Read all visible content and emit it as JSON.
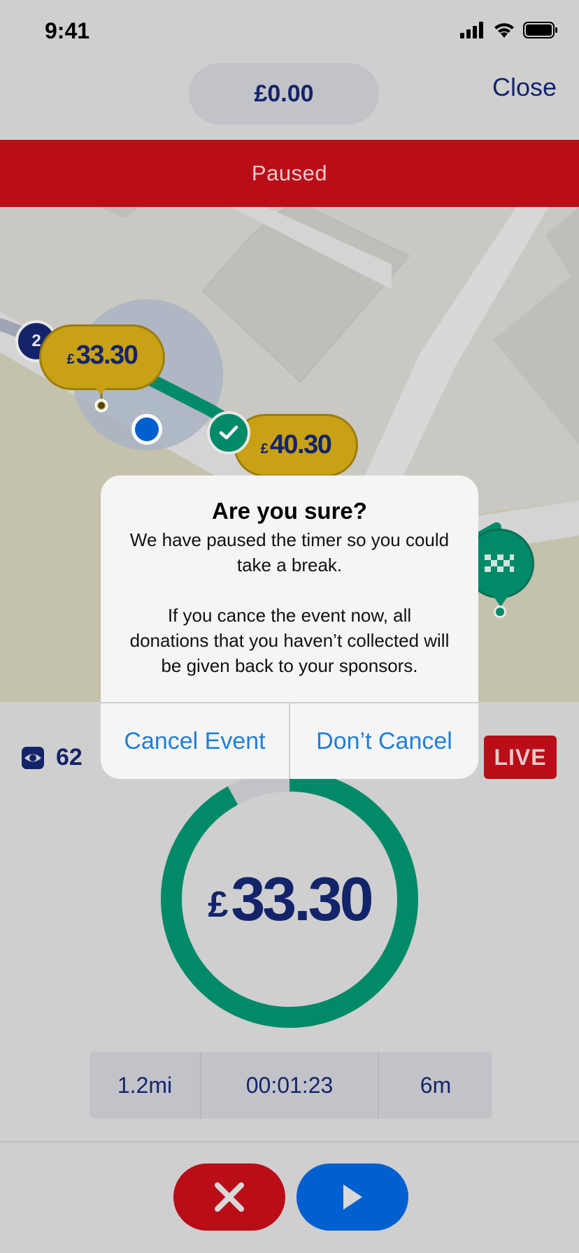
{
  "status_bar": {
    "time": "9:41"
  },
  "header": {
    "balance": "£0.00",
    "close_label": "Close"
  },
  "banner": {
    "text": "Paused"
  },
  "map": {
    "bubbles": [
      {
        "currency": "£",
        "amount": "33.30",
        "badge": "2"
      },
      {
        "currency": "£",
        "amount": "40.30",
        "status": "check"
      }
    ]
  },
  "stats": {
    "viewers": "62",
    "live_label": "LIVE",
    "ring": {
      "currency": "£",
      "amount": "33.30",
      "progress": 0.92
    },
    "distance": "1.2mi",
    "elapsed": "00:01:23",
    "remaining": "6m"
  },
  "dialog": {
    "title": "Are you sure?",
    "message_1": "We have paused the timer so you could take a break.",
    "message_2": "If you cance the event now, all donations that you haven’t collected will be given back to your sponsors.",
    "cancel_event_label": "Cancel Event",
    "dont_cancel_label": "Don’t Cancel"
  },
  "colors": {
    "accent_red": "#b90d17",
    "accent_blue": "#0060cf",
    "accent_green": "#008a68",
    "navy": "#14246b",
    "gold": "#c8a114"
  },
  "icons": [
    "signal-icon",
    "wifi-icon",
    "battery-icon",
    "eye-icon",
    "check-icon",
    "flag-icon",
    "close-icon",
    "play-icon"
  ]
}
